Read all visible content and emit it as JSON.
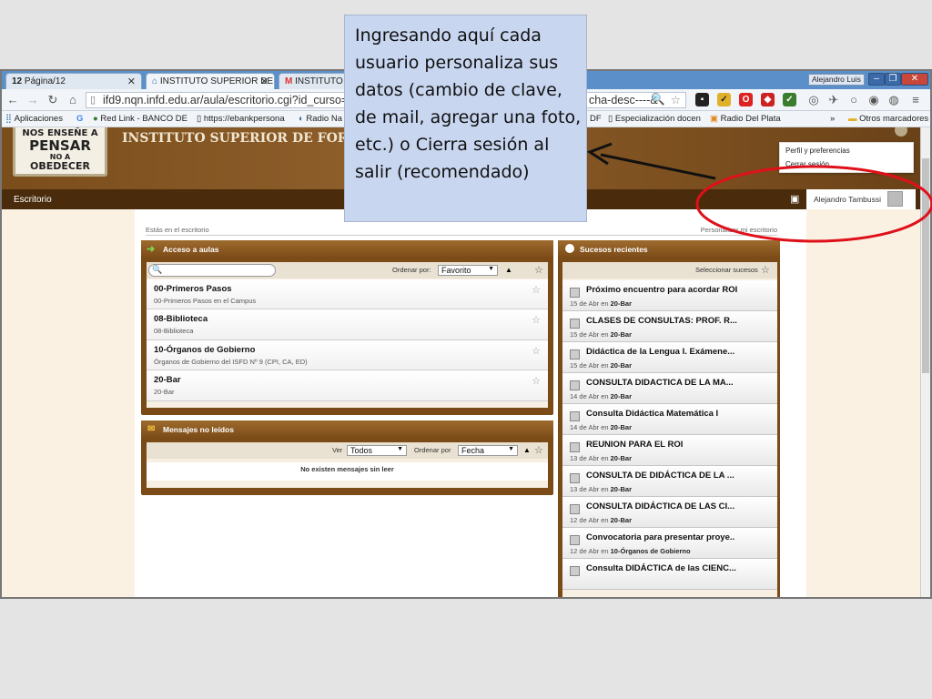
{
  "browser": {
    "tabs": [
      {
        "label": "Página/12",
        "brand": "12"
      },
      {
        "label": "INSTITUTO SUPERIOR DE"
      },
      {
        "label": "INSTITUTO SU"
      }
    ],
    "user_badge": "Alejandro Luis",
    "url": "ifd9.nqn.infd.edu.ar/aula/escritorio.cgi?id_curso=#",
    "url_tail": "cha-desc----&",
    "bookmarks": [
      "Aplicaciones",
      "Red Link - BANCO DE",
      "https://ebankpersona",
      "Radio Na",
      "DF",
      "Especialización docen",
      "Radio Del Plata",
      "Otros marcadores"
    ]
  },
  "site": {
    "logo_lines": [
      "NOS ENSEÑE A",
      "PENSAR",
      "NO A",
      "OBEDECER"
    ],
    "institution": "INSTITUTO SUPERIOR DE FORMACIÓ",
    "nav_item": "Escritorio",
    "user_name": "Alejandro Tambussi",
    "user_menu": [
      "Perfil y preferencias",
      "Cerrar sesión"
    ],
    "breadcrumb": "Estás en el escritorio",
    "customize_link": "Personalizar mi escritorio"
  },
  "courses_panel": {
    "title": "Acceso a aulas",
    "order_label": "Ordenar por:",
    "order_value": "Favorito",
    "sort_arrow": "▲",
    "items": [
      {
        "name": "00-Primeros Pasos",
        "sub": "00-Primeros Pasos en el Campus"
      },
      {
        "name": "08-Biblioteca",
        "sub": "08-Biblioteca"
      },
      {
        "name": "10-Órganos de Gobierno",
        "sub": "Órganos de Gobierno del ISFD Nº 9 (CPI, CA, ED)"
      },
      {
        "name": "20-Bar",
        "sub": "20-Bar"
      }
    ]
  },
  "messages_panel": {
    "title": "Mensajes no leídos",
    "view_label": "Ver",
    "view_value": "Todos",
    "order_label": "Ordenar por",
    "order_value": "Fecha",
    "empty_text": "No existen mensajes sin leer"
  },
  "events_panel": {
    "title": "Sucesos recientes",
    "select_label": "Seleccionar sucesos",
    "items": [
      {
        "title": "Próximo encuentro para acordar ROI",
        "date": "15 de Abr en",
        "course": "20-Bar"
      },
      {
        "title": "CLASES DE CONSULTAS: PROF. R...",
        "date": "15 de Abr en",
        "course": "20-Bar"
      },
      {
        "title": "Didáctica de la Lengua I. Exámene...",
        "date": "15 de Abr en",
        "course": "20-Bar"
      },
      {
        "title": "CONSULTA DIDACTICA DE LA MA...",
        "date": "14 de Abr en",
        "course": "20-Bar"
      },
      {
        "title": "Consulta Didáctica Matemática I",
        "date": "14 de Abr en",
        "course": "20-Bar"
      },
      {
        "title": "REUNION PARA EL ROI",
        "date": "13 de Abr en",
        "course": "20-Bar"
      },
      {
        "title": "CONSULTA DE DIDÁCTICA DE LA ...",
        "date": "13 de Abr en",
        "course": "20-Bar"
      },
      {
        "title": "CONSULTA DIDÁCTICA DE LAS CI...",
        "date": "12 de Abr en",
        "course": "20-Bar"
      },
      {
        "title": "Convocatoria para presentar proye..",
        "date": "12 de Abr en",
        "course": "10-Órganos de Gobierno"
      },
      {
        "title": "Consulta DIDÁCTICA de las CIENC...",
        "date": "",
        "course": ""
      }
    ]
  },
  "annotation": {
    "text": "Ingresando aquí cada usuario personaliza sus datos (cambio de clave, de mail, agregar una foto, etc.) o Cierra sesión al salir (recomendado)"
  },
  "colors": {
    "header_brown": "#7a4a17",
    "nav_dark": "#4a2c0c",
    "callout_red": "#e0101a",
    "note_bg": "#c8d6f0"
  }
}
